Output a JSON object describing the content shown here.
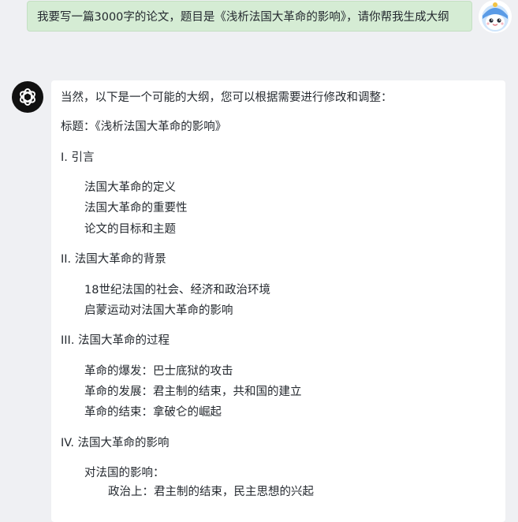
{
  "user_message": {
    "text": "我要写一篇3000字的论文，题目是《浅析法国大革命的影响》，请你帮我生成大纲"
  },
  "assistant_message": {
    "intro": "当然，以下是一个可能的大纲，您可以根据需要进行修改和调整：",
    "title_line": "标题：《浅析法国大革命的影响》",
    "sections": [
      {
        "heading": "I. 引言",
        "items": [
          "法国大革命的定义",
          "法国大革命的重要性",
          "论文的目标和主题"
        ]
      },
      {
        "heading": "II. 法国大革命的背景",
        "items": [
          "18世纪法国的社会、经济和政治环境",
          "启蒙运动对法国大革命的影响"
        ]
      },
      {
        "heading": "III. 法国大革命的过程",
        "items": [
          "革命的爆发：巴士底狱的攻击",
          "革命的发展：君主制的结束，共和国的建立",
          "革命的结束：拿破仑的崛起"
        ]
      },
      {
        "heading": "IV. 法国大革命的影响",
        "items": [
          "对法国的影响："
        ],
        "subitems": [
          "政治上：君主制的结束，民主思想的兴起"
        ]
      }
    ]
  },
  "colors": {
    "page_background": "#eff0f3",
    "user_bubble": "#d5ecd4",
    "card_background": "#ffffff",
    "bot_avatar": "#111111"
  },
  "icons": {
    "user_avatar": "cartoon-avatar-icon",
    "bot_avatar": "openai-logo-icon"
  }
}
